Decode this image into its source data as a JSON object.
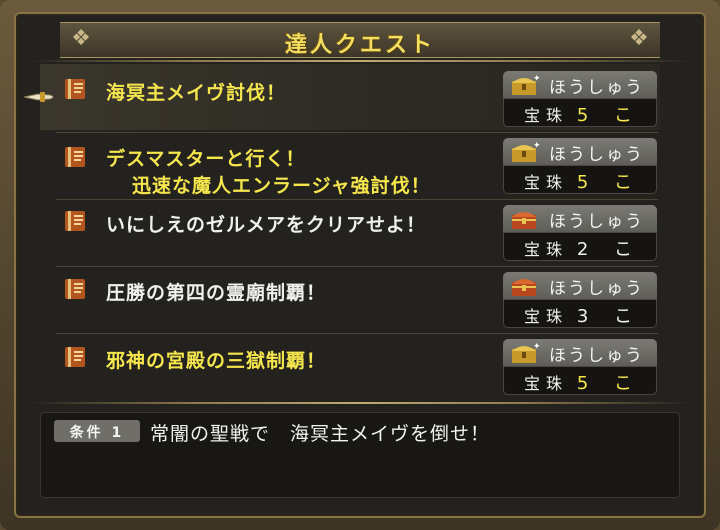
{
  "window": {
    "title": "達人クエスト"
  },
  "quests": [
    {
      "name_lines": [
        "海冥主メイヴ討伐！"
      ],
      "color": "#f5e64e",
      "reward": {
        "label": "ほうしゅう",
        "item": "宝珠",
        "count": "5 こ",
        "count_color": "#f5e64e",
        "chest": "gold"
      }
    },
    {
      "name_lines": [
        "デスマスターと行く！",
        "迅速な魔人エンラージャ強討伐！"
      ],
      "color": "#f5e64e",
      "reward": {
        "label": "ほうしゅう",
        "item": "宝珠",
        "count": "5 こ",
        "count_color": "#f5e64e",
        "chest": "gold"
      }
    },
    {
      "name_lines": [
        "いにしえのゼルメアをクリアせよ！"
      ],
      "color": "#f0f0ec",
      "reward": {
        "label": "ほうしゅう",
        "item": "宝珠",
        "count": "2 こ",
        "count_color": "#f0f0ec",
        "chest": "red"
      }
    },
    {
      "name_lines": [
        "圧勝の第四の霊廟制覇！"
      ],
      "color": "#f0f0ec",
      "reward": {
        "label": "ほうしゅう",
        "item": "宝珠",
        "count": "3 こ",
        "count_color": "#f0f0ec",
        "chest": "red"
      }
    },
    {
      "name_lines": [
        "邪神の宮殿の三獄制覇！"
      ],
      "color": "#f5e64e",
      "reward": {
        "label": "ほうしゅう",
        "item": "宝珠",
        "count": "5 こ",
        "count_color": "#f5e64e",
        "chest": "gold"
      }
    }
  ],
  "condition": {
    "badge": "条件 1",
    "text": "常闇の聖戦で　海冥主メイヴを倒せ！"
  },
  "colors": {
    "highlight_text": "#f5e64e",
    "normal_text": "#f0f0ec",
    "frame_gold": "#c2ab73"
  }
}
